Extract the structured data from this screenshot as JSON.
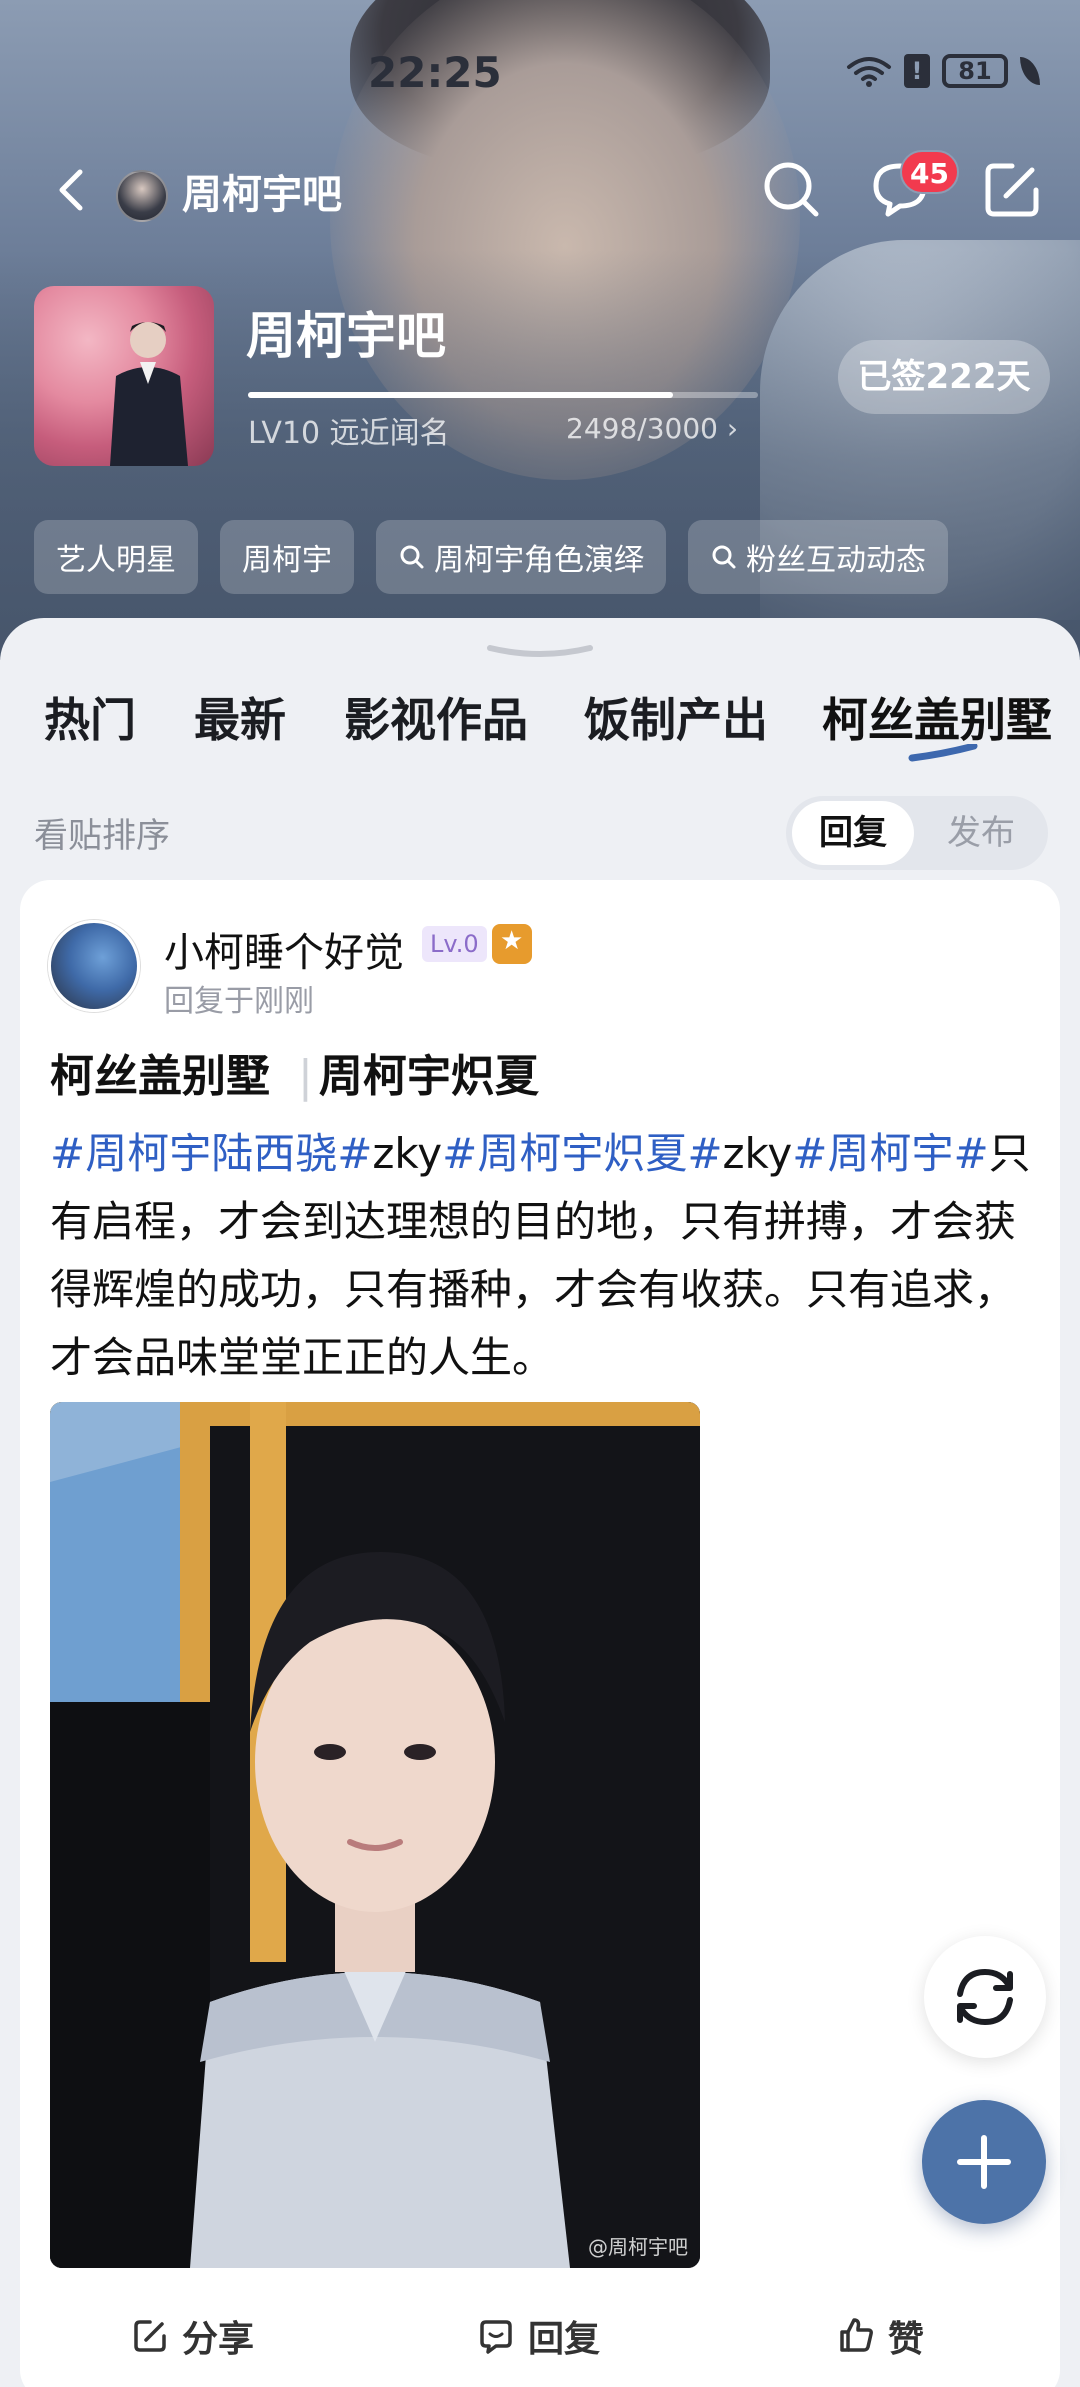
{
  "status_bar": {
    "time": "22:25",
    "battery": "81"
  },
  "nav": {
    "title": "周柯宇吧",
    "message_badge": "45"
  },
  "forum": {
    "name": "周柯宇吧",
    "level": "LV10 远近闻名",
    "exp": "2498/3000",
    "exp_fraction": 0.833,
    "checkin": "已签222天"
  },
  "tags": [
    {
      "label": "艺人明星",
      "search": false
    },
    {
      "label": "周柯宇",
      "search": false
    },
    {
      "label": "周柯宇角色演绎",
      "search": true
    },
    {
      "label": "粉丝互动动态",
      "search": true
    }
  ],
  "tabs": [
    "热门",
    "最新",
    "影视作品",
    "饭制产出",
    "柯丝盖别墅"
  ],
  "sort": {
    "label": "看贴排序",
    "options": [
      "回复",
      "发布"
    ],
    "selected": "回复"
  },
  "post": {
    "author": "小柯睡个好觉",
    "level_badge": "Lv.0",
    "time": "回复于刚刚",
    "title_left": "柯丝盖别墅",
    "title_right": "周柯宇炽夏",
    "body": {
      "hash1": "#周柯宇陆西骁#",
      "t1": "zky",
      "hash2": "#周柯宇炽夏#",
      "t2": "zky",
      "hash3": "#周柯宇#",
      "text": "只有启程，才会到达理想的目的地，只有拼搏，才会获得辉煌的成功，只有播种，才会有收获。只有追求，才会品味堂堂正正的人生。"
    },
    "image_watermark": "@周柯宇吧",
    "actions": {
      "share": "分享",
      "reply": "回复",
      "like": "赞"
    }
  },
  "colors": {
    "accent": "#4d73a8",
    "hashtag": "#2f5fc4",
    "badge": "#f23a4e"
  }
}
